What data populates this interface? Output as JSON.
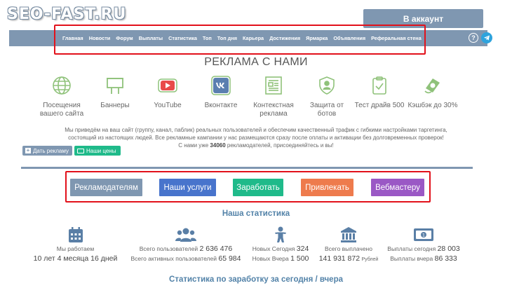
{
  "header": {
    "logo": "SEO-FAST.RU",
    "account_button": "В аккаунт"
  },
  "nav": {
    "items": [
      "Главная",
      "Новости",
      "Форум",
      "Выплаты",
      "Статистика",
      "Топ",
      "Топ дня",
      "Карьера",
      "Достижения",
      "Ярмарка",
      "Объявления",
      "Реферальная стена"
    ],
    "help_icon": "question-circle-icon",
    "telegram_icon": "telegram-icon"
  },
  "page_title": "РЕКЛАМА С НАМИ",
  "features": [
    {
      "icon": "globe-icon",
      "line1": "Посещения",
      "line2": "вашего сайта"
    },
    {
      "icon": "billboard-icon",
      "line1": "Баннеры",
      "line2": ""
    },
    {
      "icon": "youtube-icon",
      "line1": "YouTube",
      "line2": ""
    },
    {
      "icon": "vk-icon",
      "line1": "Вконтакте",
      "line2": ""
    },
    {
      "icon": "document-icon",
      "line1": "Контекстная",
      "line2": "реклама"
    },
    {
      "icon": "shield-user-icon",
      "line1": "Защита от",
      "line2": "ботов"
    },
    {
      "icon": "clipboard-check-icon",
      "line1": "Тест драйв 500",
      "line2": ""
    },
    {
      "icon": "cashback-icon",
      "line1": "Кэшбэк до 30%",
      "line2": ""
    }
  ],
  "description": {
    "line1": "Мы приведём на ваш сайт (группу, канал, паблик) реальных пользователей и обеспечим качественный трафик с гибкими настройками таргетинга,",
    "line2": "состоящий из настоящих людей. Все рекламные кампании у нас размещаются сразу после оплаты и активации без долговременных проверок!",
    "line3_pre": "С нами уже ",
    "line3_count": "34060",
    "line3_post": " рекламодателей, присоединяйтесь и вы!"
  },
  "small_buttons": {
    "ad": "Дать рекламу",
    "prices": "Наши цены"
  },
  "main_buttons": [
    "Рекламодателям",
    "Наши услуги",
    "Заработать",
    "Привлекать",
    "Вебмастеру"
  ],
  "stats_title": "Наша статистика",
  "stats": {
    "working_label": "Мы работаем",
    "working_value": "10 лет 4 месяца 16 дней",
    "total_users_label": "Всего пользователей",
    "total_users_value": "2 636 476",
    "active_users_label": "Всего активных пользователей",
    "active_users_value": "65 984",
    "new_today_label": "Новых Сегодня",
    "new_today_value": "324",
    "new_yesterday_label": "Новых Вчера",
    "new_yesterday_value": "1 500",
    "paid_label": "Всего выплачено",
    "paid_value": "141 931 872",
    "paid_currency": "Рублей",
    "payouts_today_label": "Выплаты сегодня",
    "payouts_today_value": "28 003",
    "payouts_yesterday_label": "Выплаты вчера",
    "payouts_yesterday_value": "86 333"
  },
  "stats2_title": "Статистика по заработку за сегодня / вчера",
  "colors": {
    "nav": "#7f97b1",
    "accent_blue": "#5282a8",
    "green": "#1fba8a",
    "icon_green": "#8fc27a",
    "red_highlight": "#e2111b"
  }
}
